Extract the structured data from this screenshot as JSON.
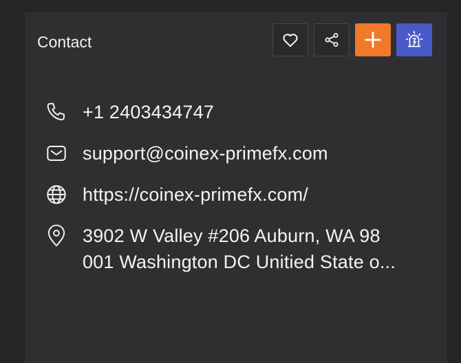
{
  "header": {
    "title": "Contact"
  },
  "actions": [
    {
      "name": "favorite-button",
      "icon": "heart-icon"
    },
    {
      "name": "share-button",
      "icon": "share-icon"
    },
    {
      "name": "add-button",
      "icon": "plus-icon",
      "color": "#f07a2a"
    },
    {
      "name": "alert-button",
      "icon": "siren-icon",
      "color": "#4a5ac9"
    }
  ],
  "contacts": {
    "phone": "+1 2403434747",
    "email": "support@coinex-primefx.com",
    "website": "https://coinex-primefx.com/",
    "address": "3902 W Valley #206 Auburn, WA 98\n001 Washington DC Unitied State o..."
  },
  "icons": {
    "phone": "phone-icon",
    "email": "envelope-icon",
    "website": "globe-icon",
    "address": "location-pin-icon"
  }
}
